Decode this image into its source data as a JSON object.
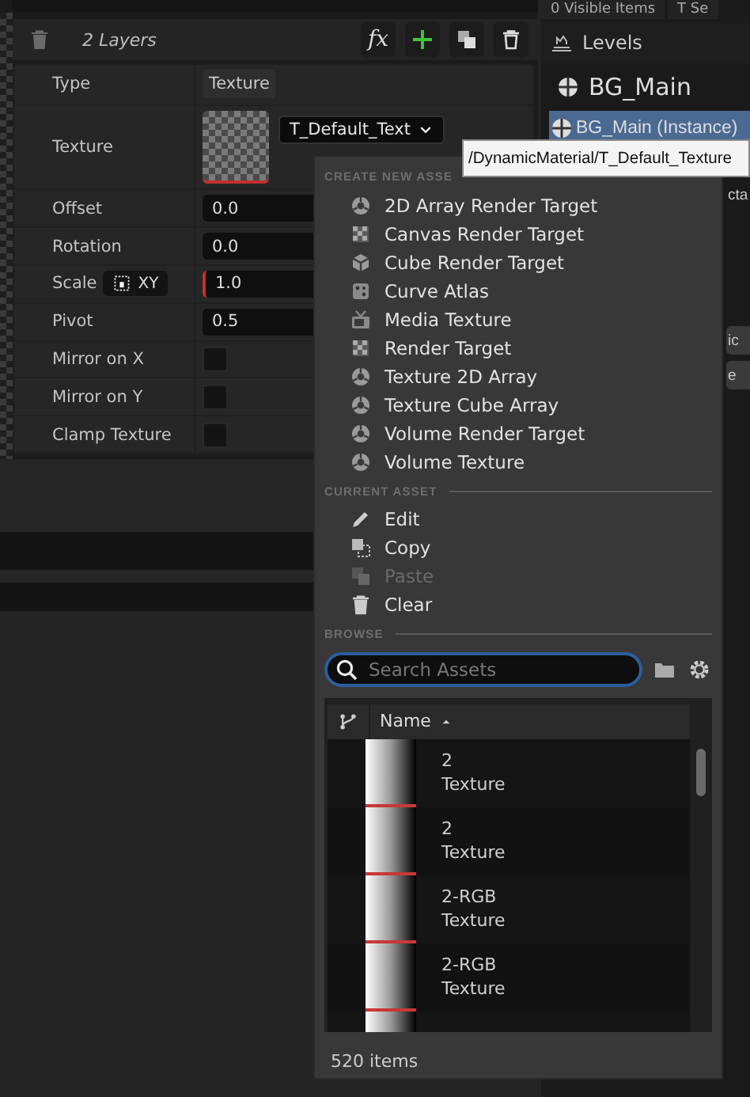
{
  "layers_toolbar": {
    "title": "2 Layers",
    "fx_label": "fx"
  },
  "properties": {
    "header": {
      "label": "Type",
      "value": "Texture"
    },
    "texture": {
      "label": "Texture",
      "asset": "T_Default_Text"
    },
    "rows": [
      {
        "kind": "number",
        "label": "Offset",
        "value": "0.0"
      },
      {
        "kind": "number",
        "label": "Rotation",
        "value": "0.0"
      },
      {
        "kind": "scale",
        "label": "Scale",
        "toggle": "XY",
        "value": "1.0"
      },
      {
        "kind": "number",
        "label": "Pivot",
        "value": "0.5"
      },
      {
        "kind": "checkbox",
        "label": "Mirror on X",
        "checked": false
      },
      {
        "kind": "checkbox",
        "label": "Mirror on Y",
        "checked": false
      },
      {
        "kind": "checkbox",
        "label": "Clamp Texture",
        "checked": false
      }
    ]
  },
  "outliner": {
    "tabs": [
      {
        "label": "0 Visible Items"
      },
      {
        "label": "T Se"
      }
    ],
    "header": "Levels",
    "items": [
      {
        "label": "BG_Main",
        "selected": false
      },
      {
        "label": "BG_Main (Instance)",
        "selected": true
      }
    ],
    "fragments": [
      {
        "text": "cta",
        "kind": "text"
      },
      {
        "text": "ic",
        "kind": "field"
      },
      {
        "text": "e",
        "kind": "field"
      }
    ]
  },
  "tooltip": "/DynamicMaterial/T_Default_Texture",
  "asset_menu": {
    "create_header": "CREATE NEW ASSE",
    "create_items": [
      {
        "label": "2D Array Render Target",
        "kind": "sphere"
      },
      {
        "label": "Canvas Render Target",
        "kind": "grid"
      },
      {
        "label": "Cube Render Target",
        "kind": "cube"
      },
      {
        "label": "Curve Atlas",
        "kind": "atlas"
      },
      {
        "label": "Media Texture",
        "kind": "media"
      },
      {
        "label": "Render Target",
        "kind": "grid"
      },
      {
        "label": "Texture 2D Array",
        "kind": "sphere"
      },
      {
        "label": "Texture Cube Array",
        "kind": "sphere"
      },
      {
        "label": "Volume Render Target",
        "kind": "sphere"
      },
      {
        "label": "Volume Texture",
        "kind": "sphere"
      }
    ],
    "current_header": "CURRENT ASSET",
    "current_items": [
      {
        "label": "Edit",
        "kind": "edit",
        "disabled": false
      },
      {
        "label": "Copy",
        "kind": "copy",
        "disabled": false
      },
      {
        "label": "Paste",
        "kind": "paste",
        "disabled": true
      },
      {
        "label": "Clear",
        "kind": "clear",
        "disabled": false
      }
    ],
    "browse_header": "BROWSE",
    "search": {
      "placeholder": "Search Assets"
    },
    "list": {
      "column": "Name",
      "rows": [
        {
          "name": "2",
          "type": "Texture"
        },
        {
          "name": "2",
          "type": "Texture"
        },
        {
          "name": "2-RGB",
          "type": "Texture"
        },
        {
          "name": "2-RGB",
          "type": "Texture"
        }
      ]
    },
    "count": "520 items"
  }
}
